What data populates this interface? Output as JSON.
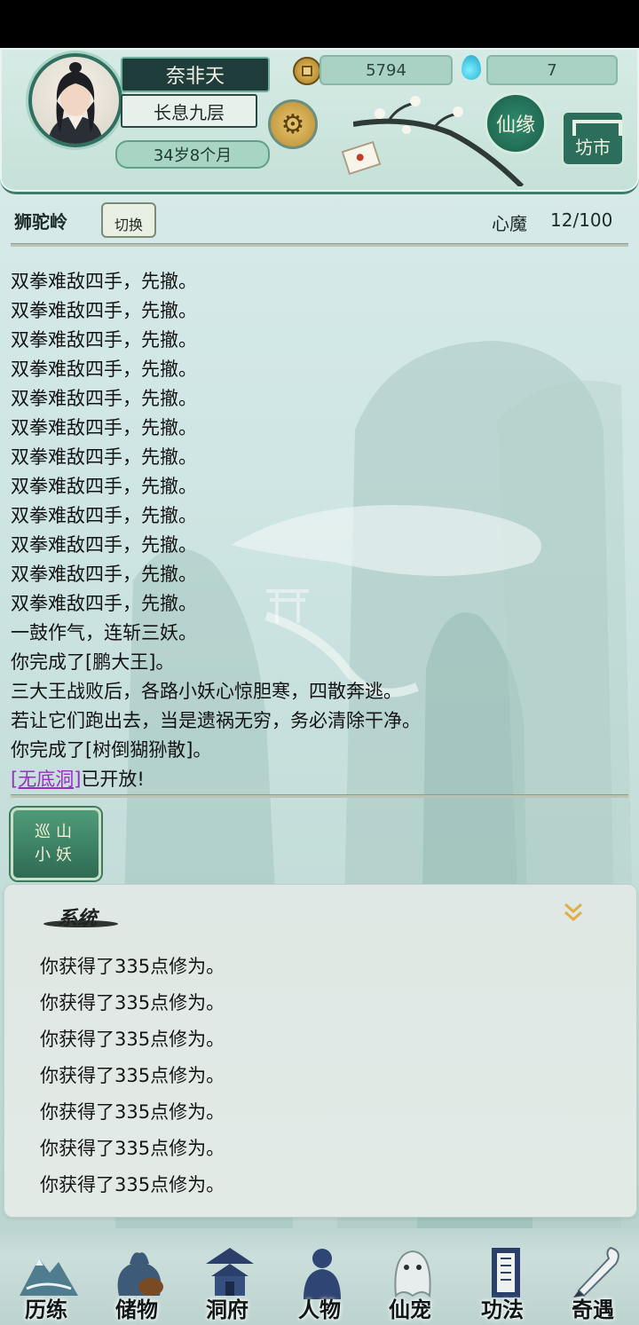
{
  "player": {
    "name": "奈非天",
    "rank": "长息九层",
    "age": "34岁8个月"
  },
  "currency": {
    "coins": "5794",
    "spirit_stones": "7"
  },
  "header_buttons": {
    "xianyuan": "仙缘",
    "fangshi": "坊市"
  },
  "location": {
    "name": "狮驼岭",
    "switch_label": "切换",
    "xinmo_label": "心魔",
    "xinmo_value": "12/100"
  },
  "log": [
    "双拳难敌四手，先撤。",
    "双拳难敌四手，先撤。",
    "双拳难敌四手，先撤。",
    "双拳难敌四手，先撤。",
    "双拳难敌四手，先撤。",
    "双拳难敌四手，先撤。",
    "双拳难敌四手，先撤。",
    "双拳难敌四手，先撤。",
    "双拳难敌四手，先撤。",
    "双拳难敌四手，先撤。",
    "双拳难敌四手，先撤。",
    "双拳难敌四手，先撤。",
    "一鼓作气，连斩三妖。",
    "你完成了[鹏大王]。",
    "三大王战败后，各路小妖心惊胆寒，四散奔逃。",
    "若让它们跑出去，当是遗祸无穷，务必清除干净。",
    "你完成了[树倒猢狲散]。"
  ],
  "unlock": {
    "link": "[无底洞]",
    "suffix": "已开放!"
  },
  "patrol_button": {
    "line1": "巡山",
    "line2": "小妖"
  },
  "system": {
    "title": "系统",
    "lines": [
      "你获得了335点修为。",
      "你获得了335点修为。",
      "你获得了335点修为。",
      "你获得了335点修为。",
      "你获得了335点修为。",
      "你获得了335点修为。",
      "你获得了335点修为。"
    ]
  },
  "nav": [
    {
      "label": "历练",
      "icon": "mountain-icon"
    },
    {
      "label": "储物",
      "icon": "bag-icon"
    },
    {
      "label": "洞府",
      "icon": "pavilion-icon"
    },
    {
      "label": "人物",
      "icon": "person-icon"
    },
    {
      "label": "仙宠",
      "icon": "pet-icon"
    },
    {
      "label": "功法",
      "icon": "book-icon"
    },
    {
      "label": "奇遇",
      "icon": "brush-icon"
    }
  ],
  "colors": {
    "accent": "#2d6b53",
    "link": "#9a2ec4",
    "background": "#cfe6e4"
  }
}
